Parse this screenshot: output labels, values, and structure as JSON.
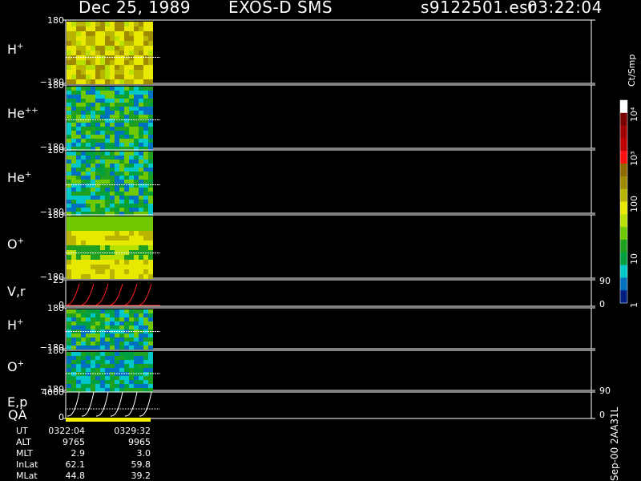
{
  "header": {
    "date": "Dec 25, 1989",
    "instrument": "EXOS-D SMS",
    "file": "s9122501.esr",
    "time": "03:22:04"
  },
  "panels": [
    {
      "name": "H",
      "sup": "+",
      "ymax": "180",
      "ymin": "−180",
      "kind": "H1"
    },
    {
      "name": "He",
      "sup": "++",
      "ymax": "180",
      "ymin": "−180",
      "kind": "He2"
    },
    {
      "name": "He",
      "sup": "+",
      "ymax": "180",
      "ymin": "−180",
      "kind": "He1"
    },
    {
      "name": "O",
      "sup": "+",
      "ymax": "180",
      "ymin": "−180",
      "kind": "O1"
    },
    {
      "name": "V,r",
      "sup": "",
      "ymax": "25",
      "ymin": "0",
      "kind": "Vr"
    },
    {
      "name": "H",
      "sup": "+",
      "ymax": "180",
      "ymin": "−180",
      "kind": "H1b"
    },
    {
      "name": "O",
      "sup": "+",
      "ymax": "180",
      "ymin": "−180",
      "kind": "O1b"
    },
    {
      "name": "E,p",
      "sup": "",
      "ymax": "4000",
      "ymin": "0",
      "kind": "Ep"
    }
  ],
  "qa_label": "QA",
  "right_axis": {
    "vr_top": "90",
    "vr_bottom": "0",
    "ep_top": "90",
    "ep_bottom": "0"
  },
  "colorbar": {
    "label": "Ct/Smp",
    "ticks": [
      "10⁴",
      "10³",
      "100",
      "10",
      "1"
    ],
    "colors": [
      "#ffffff",
      "#7a0000",
      "#a00000",
      "#c00000",
      "#ff1010",
      "#8c6a00",
      "#a08a00",
      "#b8b400",
      "#e8e800",
      "#b8e000",
      "#70c800",
      "#20a020",
      "#00a040",
      "#00c8c8",
      "#0070c0",
      "#002080"
    ]
  },
  "side_text": "Sep-00 2AA31L",
  "table": {
    "rows": [
      {
        "label": "UT",
        "start": "0322:04",
        "end": "0329:32"
      },
      {
        "label": "ALT",
        "start": "9765",
        "end": "9965"
      },
      {
        "label": "MLT",
        "start": "2.9",
        "end": "3.0"
      },
      {
        "label": "InLat",
        "start": "62.1",
        "end": "59.8"
      },
      {
        "label": "MLat",
        "start": "44.8",
        "end": "39.2"
      }
    ]
  },
  "chart_data": {
    "type": "heatmap",
    "title": "Dec 25, 1989   EXOS-D SMS",
    "panels": [
      "H+",
      "He++",
      "He+",
      "O+",
      "V,r",
      "H+",
      "O+",
      "E,p"
    ],
    "y_ranges": [
      [
        -180,
        180
      ],
      [
        -180,
        180
      ],
      [
        -180,
        180
      ],
      [
        -180,
        180
      ],
      [
        0,
        25
      ],
      [
        -180,
        180
      ],
      [
        -180,
        180
      ],
      [
        0,
        4000
      ]
    ],
    "x_range": [
      "0322:04",
      "0329:32"
    ],
    "colorbar_scale": "log",
    "colorbar_range": [
      1,
      10000
    ],
    "colorbar_unit": "Ct/Smp"
  }
}
